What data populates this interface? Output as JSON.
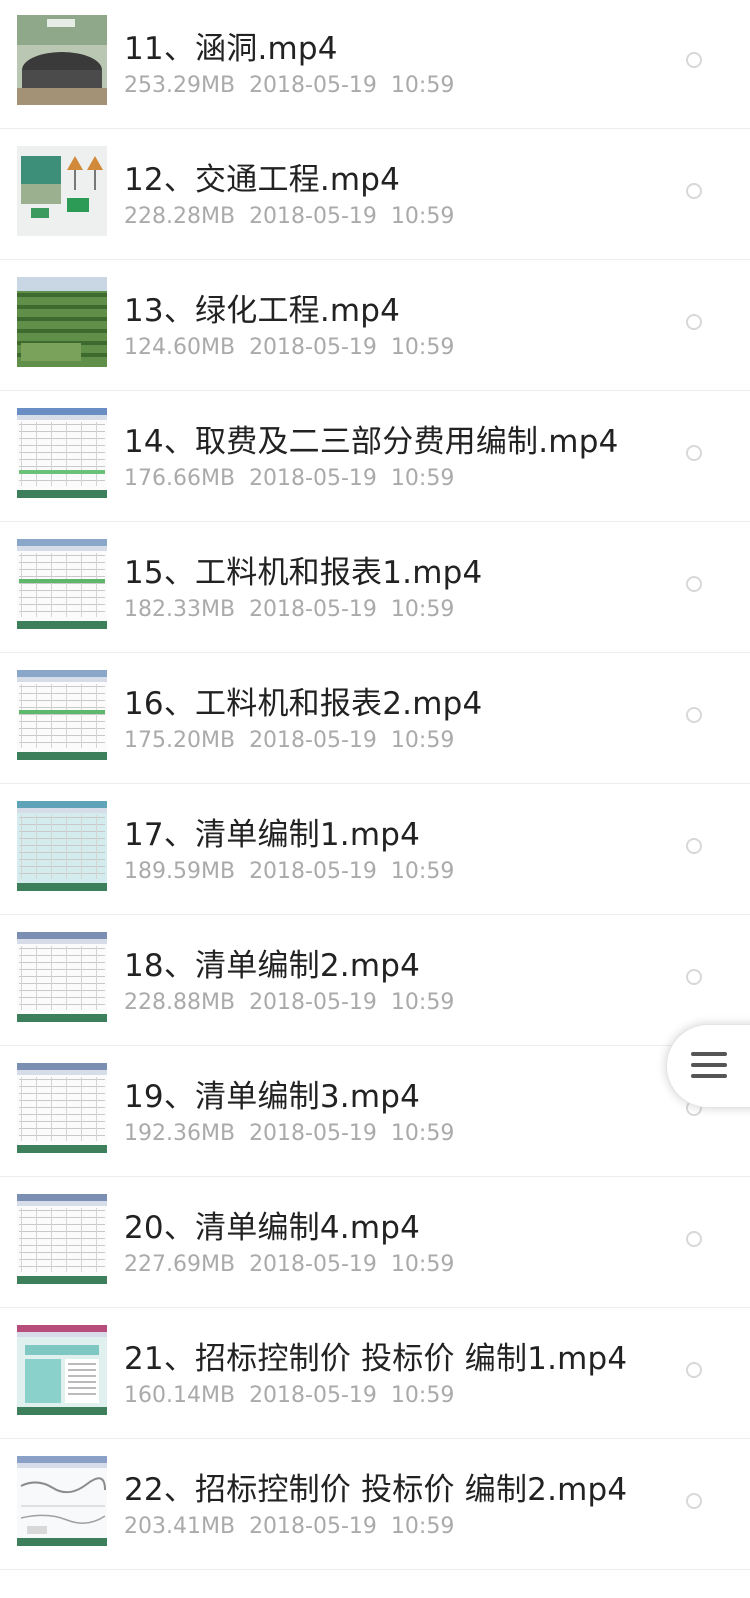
{
  "files": [
    {
      "name": "11、涵洞.mp4",
      "size": "253.29MB",
      "date": "2018-05-19",
      "time": "10:59",
      "thumb": "culvert"
    },
    {
      "name": "12、交通工程.mp4",
      "size": "228.28MB",
      "date": "2018-05-19",
      "time": "10:59",
      "thumb": "traffic"
    },
    {
      "name": "13、绿化工程.mp4",
      "size": "124.60MB",
      "date": "2018-05-19",
      "time": "10:59",
      "thumb": "greening"
    },
    {
      "name": "14、取费及二三部分费用编制.mp4",
      "size": "176.66MB",
      "date": "2018-05-19",
      "time": "10:59",
      "thumb": "spreadsheet-blue"
    },
    {
      "name": "15、工料机和报表1.mp4",
      "size": "182.33MB",
      "date": "2018-05-19",
      "time": "10:59",
      "thumb": "spreadsheet-green"
    },
    {
      "name": "16、工料机和报表2.mp4",
      "size": "175.20MB",
      "date": "2018-05-19",
      "time": "10:59",
      "thumb": "spreadsheet-green"
    },
    {
      "name": "17、清单编制1.mp4",
      "size": "189.59MB",
      "date": "2018-05-19",
      "time": "10:59",
      "thumb": "spreadsheet-teal"
    },
    {
      "name": "18、清单编制2.mp4",
      "size": "228.88MB",
      "date": "2018-05-19",
      "time": "10:59",
      "thumb": "spreadsheet-grey"
    },
    {
      "name": "19、清单编制3.mp4",
      "size": "192.36MB",
      "date": "2018-05-19",
      "time": "10:59",
      "thumb": "spreadsheet-grey"
    },
    {
      "name": "20、清单编制4.mp4",
      "size": "227.69MB",
      "date": "2018-05-19",
      "time": "10:59",
      "thumb": "spreadsheet-grey"
    },
    {
      "name": "21、招标控制价 投标价 编制1.mp4",
      "size": "160.14MB",
      "date": "2018-05-19",
      "time": "10:59",
      "thumb": "document-teal"
    },
    {
      "name": "22、招标控制价 投标价 编制2.mp4",
      "size": "203.41MB",
      "date": "2018-05-19",
      "time": "10:59",
      "thumb": "drawing"
    }
  ],
  "floating_menu": {
    "icon": "menu-icon"
  }
}
